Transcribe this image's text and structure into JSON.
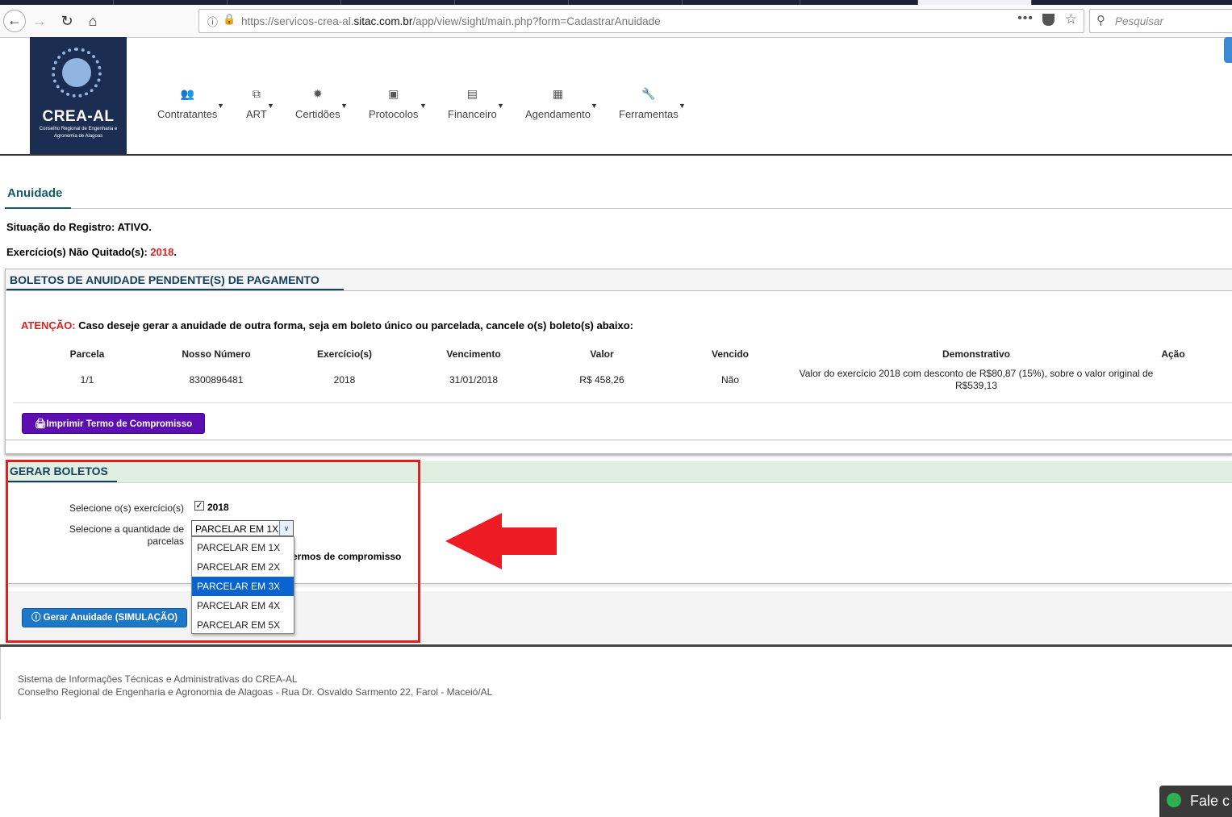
{
  "browser": {
    "url_prefix": "https://servicos-crea-al.",
    "url_domain": "sitac.com.br",
    "url_path": "/app/view/sight/main.php?form=CadastrarAnuidade",
    "search_placeholder": "Pesquisar"
  },
  "logo": {
    "name": "CREA-AL",
    "sub": "Conselho Regional de Engenharia e Agronomia de Alagoas"
  },
  "menu": [
    {
      "label": "Contratantes",
      "icon": "users-icon"
    },
    {
      "label": "ART",
      "icon": "copy-icon"
    },
    {
      "label": "Certidões",
      "icon": "certificate-icon"
    },
    {
      "label": "Protocolos",
      "icon": "inbox-icon"
    },
    {
      "label": "Financeiro",
      "icon": "money-icon"
    },
    {
      "label": "Agendamento",
      "icon": "calendar-icon"
    },
    {
      "label": "Ferramentas",
      "icon": "wrench-icon"
    }
  ],
  "page": {
    "tab_title": "Anuidade",
    "status_label": "Situação do Registro: ATIVO.",
    "exerc_label": "Exercício(s) Não Quitado(s): ",
    "exerc_year": "2018",
    "exerc_end": "."
  },
  "pending": {
    "title": "BOLETOS DE ANUIDADE PENDENTE(S) DE PAGAMENTO",
    "atencao_label": "ATENÇÃO:",
    "atencao_text": " Caso deseje gerar a anuidade de outra forma, seja em boleto único ou parcelada, cancele o(s) boleto(s) abaixo:",
    "headers": [
      "Parcela",
      "Nosso Número",
      "Exercício(s)",
      "Vencimento",
      "Valor",
      "Vencido",
      "Demonstrativo",
      "Ação"
    ],
    "row": {
      "parcela": "1/1",
      "nosso_numero": "8300896481",
      "exercicio": "2018",
      "vencimento": "31/01/2018",
      "valor": "R$ 458,26",
      "vencido": "Não",
      "demonstrativo": "Valor do exercício 2018 com desconto de R$80,87 (15%), sobre o valor original de R$539,13"
    },
    "print_button": "Imprimir Termo de Compromisso"
  },
  "gerar": {
    "title": "GERAR BOLETOS",
    "select_exercicio_label": "Selecione o(s) exercício(s)",
    "exercicio_option": "2018",
    "select_parcelas_label": "Selecione a quantidade de parcelas",
    "selected": "PARCELAR EM 1X",
    "options": [
      "PARCELAR EM 1X",
      "PARCELAR EM 2X",
      "PARCELAR EM 3X",
      "PARCELAR EM 4X",
      "PARCELAR EM 5X"
    ],
    "highlighted_option": "PARCELAR EM 3X",
    "termos_text": "ermos de compromisso",
    "gerar_button": "Gerar Anuidade (SIMULAÇÃO)"
  },
  "footer": {
    "line1": "Sistema de Informações Técnicas e Administrativas do CREA-AL",
    "line2": "Conselho Regional de Engenharia e Agronomia de Alagoas - Rua Dr. Osvaldo Sarmento 22, Farol - Maceió/AL"
  },
  "chat": {
    "label": "Fale c"
  },
  "colors": {
    "accent_red": "#d9231e",
    "header_navy": "#1c2d52",
    "button_purple": "#5c0eb3",
    "button_blue": "#1d77c8"
  }
}
